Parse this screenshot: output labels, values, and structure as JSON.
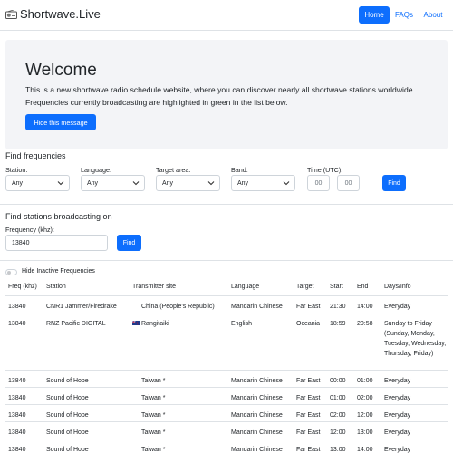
{
  "brand": {
    "name": "Shortwave.Live",
    "icon": "radio-icon"
  },
  "nav": {
    "home": "Home",
    "faqs": "FAQs",
    "about": "About"
  },
  "jumbotron": {
    "title": "Welcome",
    "text": "This is a new shortwave radio schedule website, where you can discover nearly all shortwave stations worldwide. Frequencies currently broadcasting are highlighted in green in the list below.",
    "hide_button": "Hide this message"
  },
  "find_frequencies": {
    "title": "Find frequencies",
    "station_label": "Station:",
    "station_value": "Any",
    "language_label": "Language:",
    "language_value": "Any",
    "target_label": "Target area:",
    "target_value": "Any",
    "band_label": "Band:",
    "band_value": "Any",
    "time_label": "Time (UTC):",
    "time_hour_placeholder": "00",
    "time_minute_placeholder": "00",
    "find_button": "Find"
  },
  "find_stations": {
    "title": "Find stations broadcasting on",
    "freq_label": "Frequency (khz):",
    "freq_value": "13840",
    "find_button": "Find"
  },
  "toggle_label": "Hide Inactive Frequencies",
  "table": {
    "headers": [
      "Freq (khz)",
      "Station",
      "Transmitter site",
      "Language",
      "Target",
      "Start",
      "End",
      "Days/Info"
    ],
    "rows": [
      {
        "freq": "13840",
        "station": "CNR1 Jammer/Firedrake",
        "site": "China (People's Republic)",
        "language": "Mandarin Chinese",
        "target": "Far East",
        "start": "21:30",
        "end": "14:00",
        "days": "Everyday"
      },
      {
        "freq": "13840",
        "station": "RNZ Pacific DIGITAL",
        "site": "Rangitaiki",
        "language": "English",
        "target": "Oceania",
        "start": "18:59",
        "end": "20:58",
        "days": "Sunday to Friday (Sunday, Monday, Tuesday, Wednesday, Thursday, Friday)"
      },
      {
        "freq": "13840",
        "station": "Sound of Hope",
        "site": "Taiwan *",
        "language": "Mandarin Chinese",
        "target": "Far East",
        "start": "00:00",
        "end": "01:00",
        "days": "Everyday"
      },
      {
        "freq": "13840",
        "station": "Sound of Hope",
        "site": "Taiwan *",
        "language": "Mandarin Chinese",
        "target": "Far East",
        "start": "01:00",
        "end": "02:00",
        "days": "Everyday"
      },
      {
        "freq": "13840",
        "station": "Sound of Hope",
        "site": "Taiwan *",
        "language": "Mandarin Chinese",
        "target": "Far East",
        "start": "02:00",
        "end": "12:00",
        "days": "Everyday"
      },
      {
        "freq": "13840",
        "station": "Sound of Hope",
        "site": "Taiwan *",
        "language": "Mandarin Chinese",
        "target": "Far East",
        "start": "12:00",
        "end": "13:00",
        "days": "Everyday"
      },
      {
        "freq": "13840",
        "station": "Sound of Hope",
        "site": "Taiwan *",
        "language": "Mandarin Chinese",
        "target": "Far East",
        "start": "13:00",
        "end": "14:00",
        "days": "Everyday"
      }
    ]
  },
  "colors": {
    "primary": "#0d6efd",
    "jumbotron_bg": "#f3f4f7",
    "border": "#dee2e6"
  }
}
